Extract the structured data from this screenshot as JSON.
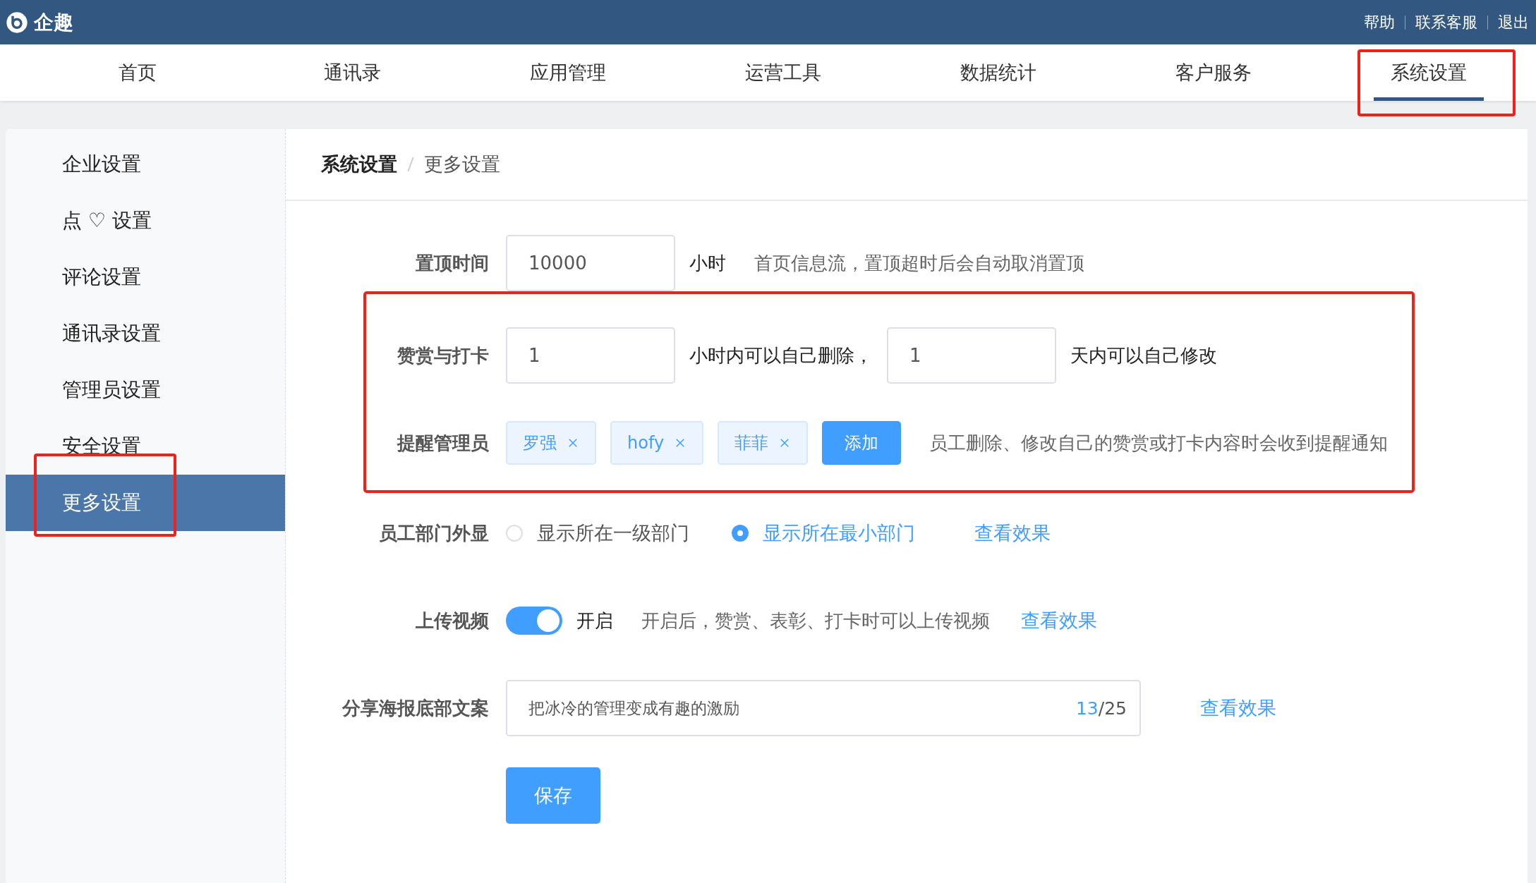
{
  "header": {
    "logo_text": "企趣",
    "links": [
      "帮助",
      "联系客服",
      "退出"
    ]
  },
  "nav": [
    {
      "label": "首页",
      "selected": false,
      "highlighted": false
    },
    {
      "label": "通讯录",
      "selected": false,
      "highlighted": false
    },
    {
      "label": "应用管理",
      "selected": false,
      "highlighted": false
    },
    {
      "label": "运营工具",
      "selected": false,
      "highlighted": false
    },
    {
      "label": "数据统计",
      "selected": false,
      "highlighted": false
    },
    {
      "label": "客户服务",
      "selected": false,
      "highlighted": false
    },
    {
      "label": "系统设置",
      "selected": true,
      "highlighted": true
    }
  ],
  "sidebar": {
    "items": [
      {
        "label": "企业设置",
        "selected": false,
        "highlighted": false
      },
      {
        "label": "点 ♡ 设置",
        "selected": false,
        "highlighted": false
      },
      {
        "label": "评论设置",
        "selected": false,
        "highlighted": false
      },
      {
        "label": "通讯录设置",
        "selected": false,
        "highlighted": false
      },
      {
        "label": "管理员设置",
        "selected": false,
        "highlighted": false
      },
      {
        "label": "安全设置",
        "selected": false,
        "highlighted": false
      },
      {
        "label": "更多设置",
        "selected": true,
        "highlighted": true
      }
    ]
  },
  "breadcrumb": [
    "系统设置",
    "更多设置"
  ],
  "form": {
    "pin_time": {
      "label": "置顶时间",
      "value": "10000",
      "unit": "小时",
      "hint": "首页信息流，置顶超时后会自动取消置顶"
    },
    "highlighted_group": {
      "highlighted": true,
      "reward": {
        "label": "赞赏与打卡",
        "value1": "1",
        "text1": "小时内可以自己删除，",
        "value2": "1",
        "text2": "天内可以自己修改"
      },
      "notify": {
        "label": "提醒管理员",
        "tags": [
          "罗强",
          "hofy",
          "菲菲"
        ],
        "add_button": "添加",
        "hint": "员工删除、修改自己的赞赏或打卡内容时会收到提醒通知"
      }
    },
    "department": {
      "label": "员工部门外显",
      "options": [
        {
          "label": "显示所在一级部门",
          "selected": false
        },
        {
          "label": "显示所在最小部门",
          "selected": true
        }
      ],
      "link": "查看效果"
    },
    "video": {
      "label": "上传视频",
      "on": true,
      "state_text": "开启",
      "hint": "开启后，赞赏、表彰、打卡时可以上传视频",
      "link": "查看效果"
    },
    "poster": {
      "label": "分享海报底部文案",
      "value": "把冰冷的管理变成有趣的激励",
      "count": "13",
      "limit": "/25",
      "link": "查看效果"
    },
    "save_button": "保存"
  }
}
